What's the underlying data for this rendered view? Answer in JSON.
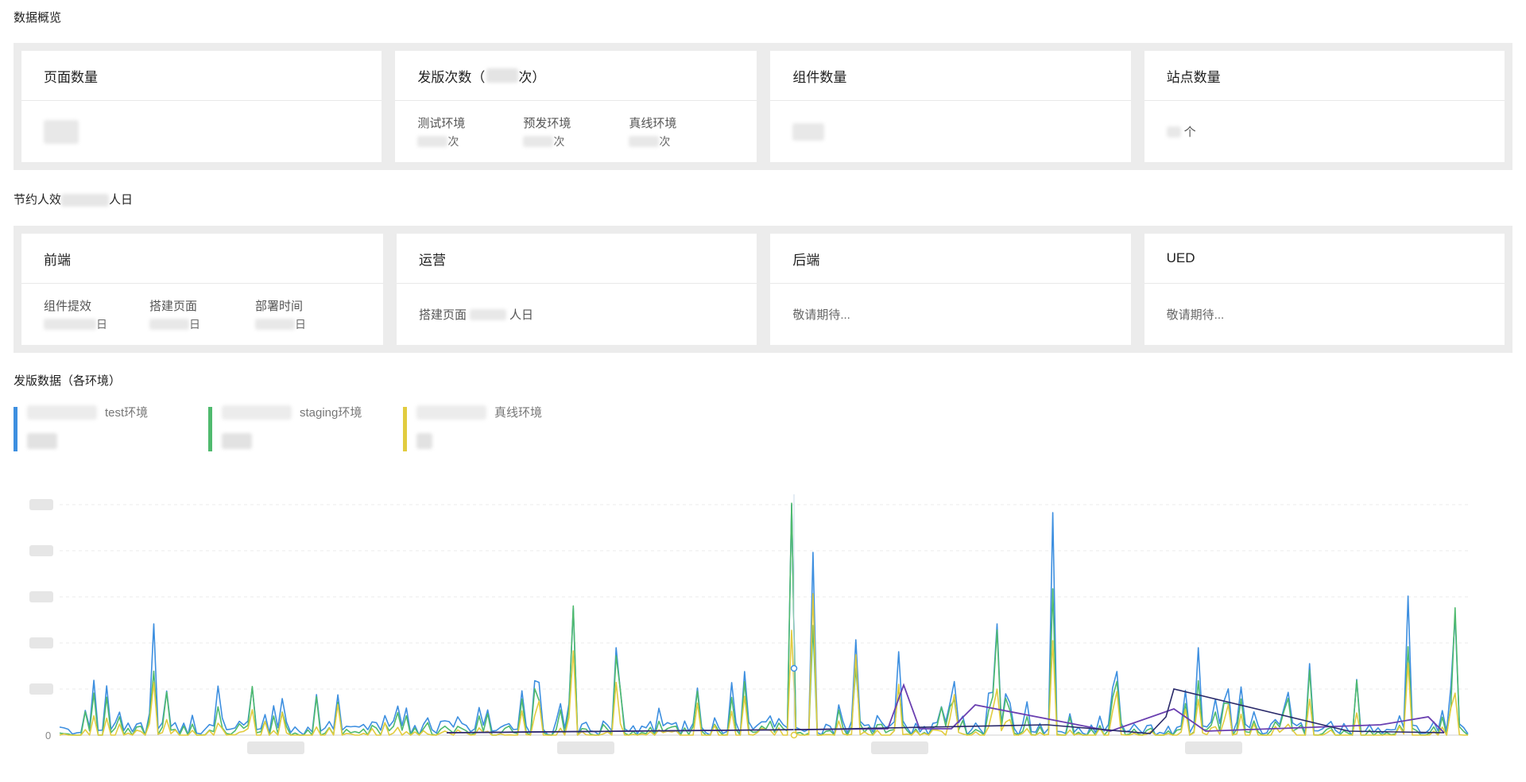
{
  "overview": {
    "title": "数据概览",
    "cards": [
      {
        "title": "页面数量",
        "unit": ""
      },
      {
        "title": "发版次数（",
        "title_suffix": "次）",
        "metrics": [
          {
            "label": "测试环境",
            "unit": "次"
          },
          {
            "label": "预发环境",
            "unit": "次"
          },
          {
            "label": "真线环境",
            "unit": "次"
          }
        ]
      },
      {
        "title": "组件数量",
        "unit": ""
      },
      {
        "title": "站点数量",
        "unit": "个"
      }
    ]
  },
  "savings": {
    "title_prefix": "节约人效",
    "title_suffix": "人日",
    "cards": [
      {
        "title": "前端",
        "metrics": [
          {
            "label": "组件提效",
            "unit": "日"
          },
          {
            "label": "搭建页面",
            "unit": "日"
          },
          {
            "label": "部署时间",
            "unit": "日"
          }
        ]
      },
      {
        "title": "运营",
        "body_prefix": "搭建页面",
        "body_suffix": "人日"
      },
      {
        "title": "后端",
        "body": "敬请期待..."
      },
      {
        "title": "UED",
        "body": "敬请期待..."
      }
    ]
  },
  "release": {
    "title": "发版数据（各环境）",
    "legend": [
      {
        "name": "test环境",
        "color": "#3d8fe0"
      },
      {
        "name": "staging环境",
        "color": "#4fba6e"
      },
      {
        "name": "真线环境",
        "color": "#e2cc3f"
      }
    ]
  },
  "chart_data": {
    "type": "line",
    "y_tick_labels": [
      "0"
    ],
    "grid": "horizontal-dashed",
    "series": [
      {
        "name": "test环境",
        "color": "#3d8fe0"
      },
      {
        "name": "staging环境",
        "color": "#4fba6e"
      },
      {
        "name": "真线环境",
        "color": "#e2cc3f"
      },
      {
        "color": "#6a3fb0"
      },
      {
        "color": "#2a2a6a"
      }
    ]
  }
}
